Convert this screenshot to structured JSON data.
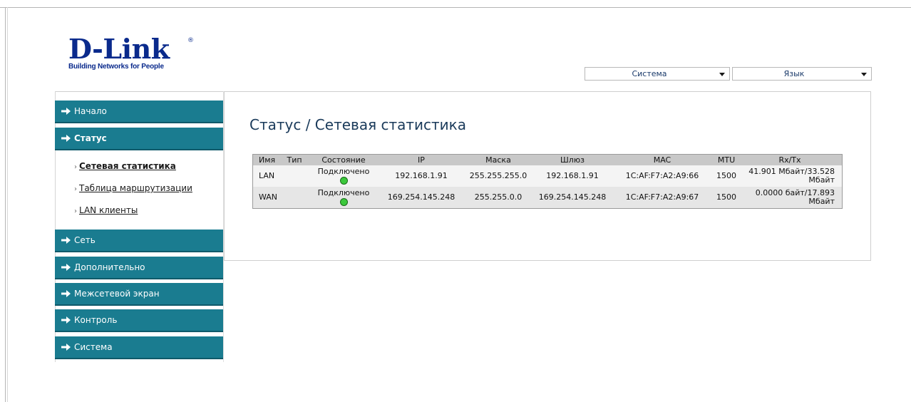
{
  "logo": {
    "brand": "D-Link",
    "tagline": "Building Networks for People"
  },
  "top_selects": {
    "system": "Система",
    "language": "Язык"
  },
  "sidebar": {
    "items": [
      {
        "label": "Начало"
      },
      {
        "label": "Статус"
      },
      {
        "label": "Сеть"
      },
      {
        "label": "Дополнительно"
      },
      {
        "label": "Межсетевой экран"
      },
      {
        "label": "Контроль"
      },
      {
        "label": "Система"
      }
    ],
    "subitems": [
      {
        "label": "Сетевая статистика",
        "active": true
      },
      {
        "label": "Таблица маршрутизации"
      },
      {
        "label": "LAN клиенты"
      }
    ]
  },
  "main": {
    "title": "Статус /  Сетевая статистика",
    "table": {
      "headers": [
        "Имя",
        "Тип",
        "Состояние",
        "IP",
        "Маска",
        "Шлюз",
        "MAC",
        "MTU",
        "Rx/Tx"
      ],
      "rows": [
        {
          "name": "LAN",
          "type": "",
          "state": "Подключено",
          "ip": "192.168.1.91",
          "mask": "255.255.255.0",
          "gateway": "192.168.1.91",
          "mac": "1C:AF:F7:A2:A9:66",
          "mtu": "1500",
          "rxtx_line1": "41.901 Мбайт/33.528",
          "rxtx_line2": "Мбайт"
        },
        {
          "name": "WAN",
          "type": "",
          "state": "Подключено",
          "ip": "169.254.145.248",
          "mask": "255.255.0.0",
          "gateway": "169.254.145.248",
          "mac": "1C:AF:F7:A2:A9:67",
          "mtu": "1500",
          "rxtx_line1": "0.0000 байт/17.893",
          "rxtx_line2": "Мбайт"
        }
      ]
    }
  },
  "colors": {
    "nav_bg": "#1a7c90",
    "brand_blue": "#0a2a8c",
    "status_ok": "#3cc83c"
  }
}
